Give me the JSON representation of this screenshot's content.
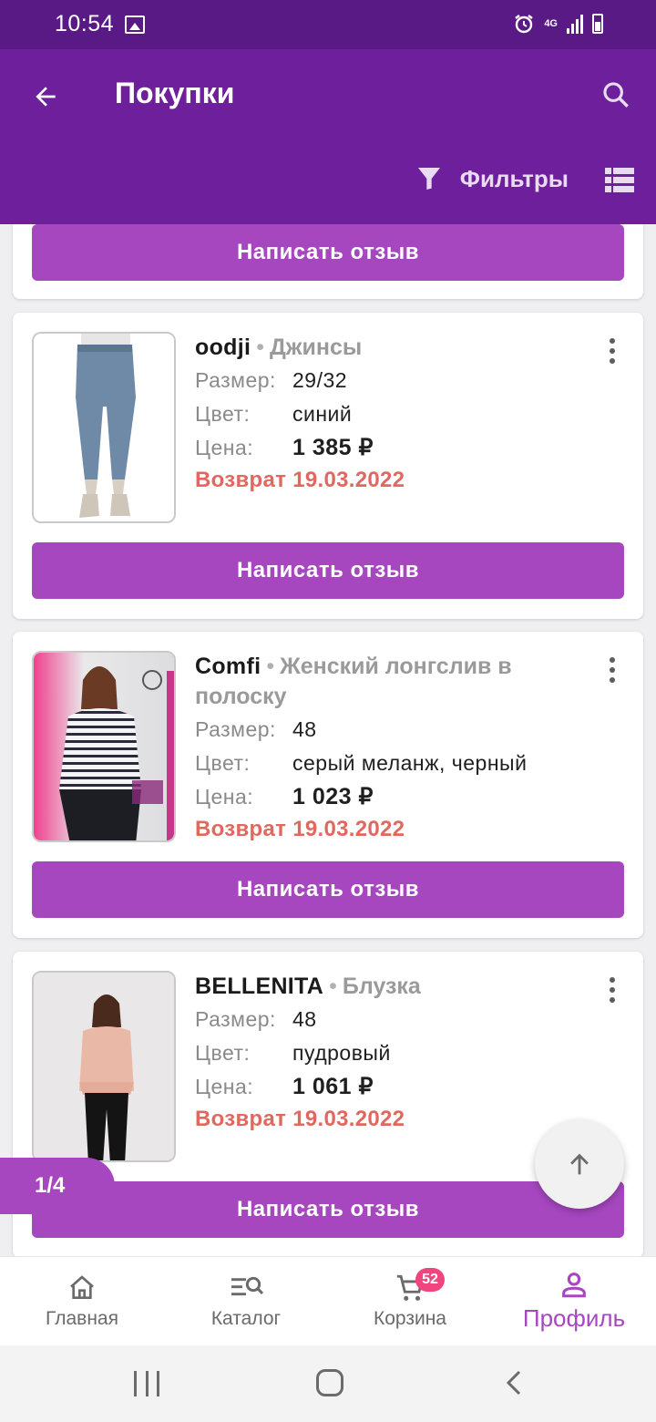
{
  "status_bar": {
    "time": "10:54",
    "network": "4G"
  },
  "header": {
    "title": "Покупки",
    "filters_label": "Фильтры"
  },
  "labels": {
    "size": "Размер:",
    "color": "Цвет:",
    "price": "Цена:"
  },
  "review_button_label": "Написать отзыв",
  "orders": [
    {
      "brand": "oodji",
      "product_type": "Джинсы",
      "size": "29/32",
      "color": "синий",
      "price": "1 385 ₽",
      "status": "Возврат 19.03.2022"
    },
    {
      "brand": "Comfi",
      "product_type": "Женский лонгслив в полоску",
      "size": "48",
      "color": "серый меланж, черный",
      "price": "1 023 ₽",
      "status": "Возврат 19.03.2022"
    },
    {
      "brand": "BELLENITA",
      "product_type": "Блузка",
      "size": "48",
      "color": "пудровый",
      "price": "1 061 ₽",
      "status": "Возврат 19.03.2022"
    }
  ],
  "pagination": {
    "label": "1/4"
  },
  "bottom_nav": {
    "items": [
      {
        "label": "Главная",
        "icon": "home-icon"
      },
      {
        "label": "Каталог",
        "icon": "catalog-search-icon"
      },
      {
        "label": "Корзина",
        "icon": "cart-icon",
        "badge": "52"
      },
      {
        "label": "Профиль",
        "icon": "profile-icon",
        "active": true
      }
    ]
  },
  "colors": {
    "status_bar": "#5a1a86",
    "app_bar": "#6e1f9c",
    "accent": "#a647bf",
    "return_status": "#e0685f",
    "cart_badge": "#f0457f"
  }
}
